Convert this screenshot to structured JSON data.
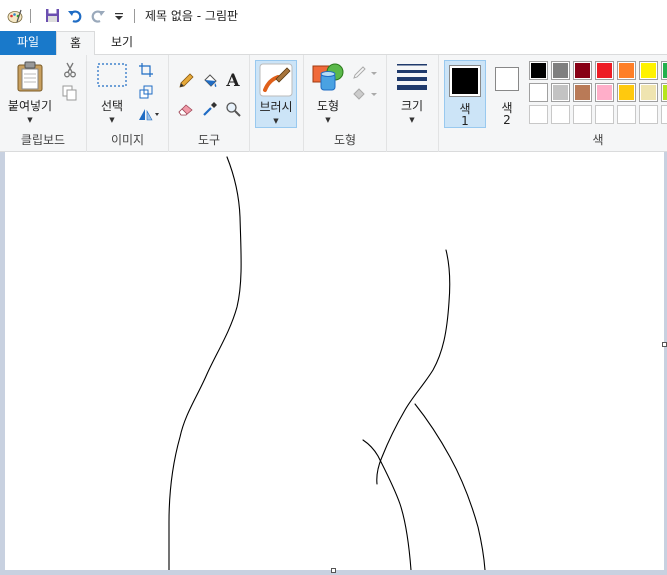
{
  "window": {
    "title": "제목 없음 - 그림판"
  },
  "tabs": {
    "file": "파일",
    "home": "홈",
    "view": "보기"
  },
  "ribbon": {
    "clipboard": {
      "paste": "붙여넣기",
      "group": "클립보드"
    },
    "image": {
      "select": "선택",
      "group": "이미지"
    },
    "tools": {
      "group": "도구"
    },
    "brushes": {
      "label": "브러시"
    },
    "shapes": {
      "label": "도형",
      "group": "도형"
    },
    "size": {
      "label": "크기"
    },
    "colors": {
      "color1": "색",
      "color1_num": "1",
      "color2": "색",
      "color2_num": "2",
      "group": "색",
      "color1_value": "#000000",
      "color2_value": "#ffffff",
      "palette_row1": [
        "#000000",
        "#7f7f7f",
        "#880015",
        "#ed1c24",
        "#ff7f27",
        "#fff200",
        "#22b14c"
      ],
      "palette_row2": [
        "#ffffff",
        "#c3c3c3",
        "#b97a57",
        "#ffaec9",
        "#ffc90e",
        "#efe4b0",
        "#b5e61d"
      ]
    }
  },
  "icons": {
    "paint_app": "paint-palette-icon",
    "save": "save-icon",
    "undo": "undo-icon",
    "redo": "redo-icon",
    "customize": "dropdown-icon"
  }
}
